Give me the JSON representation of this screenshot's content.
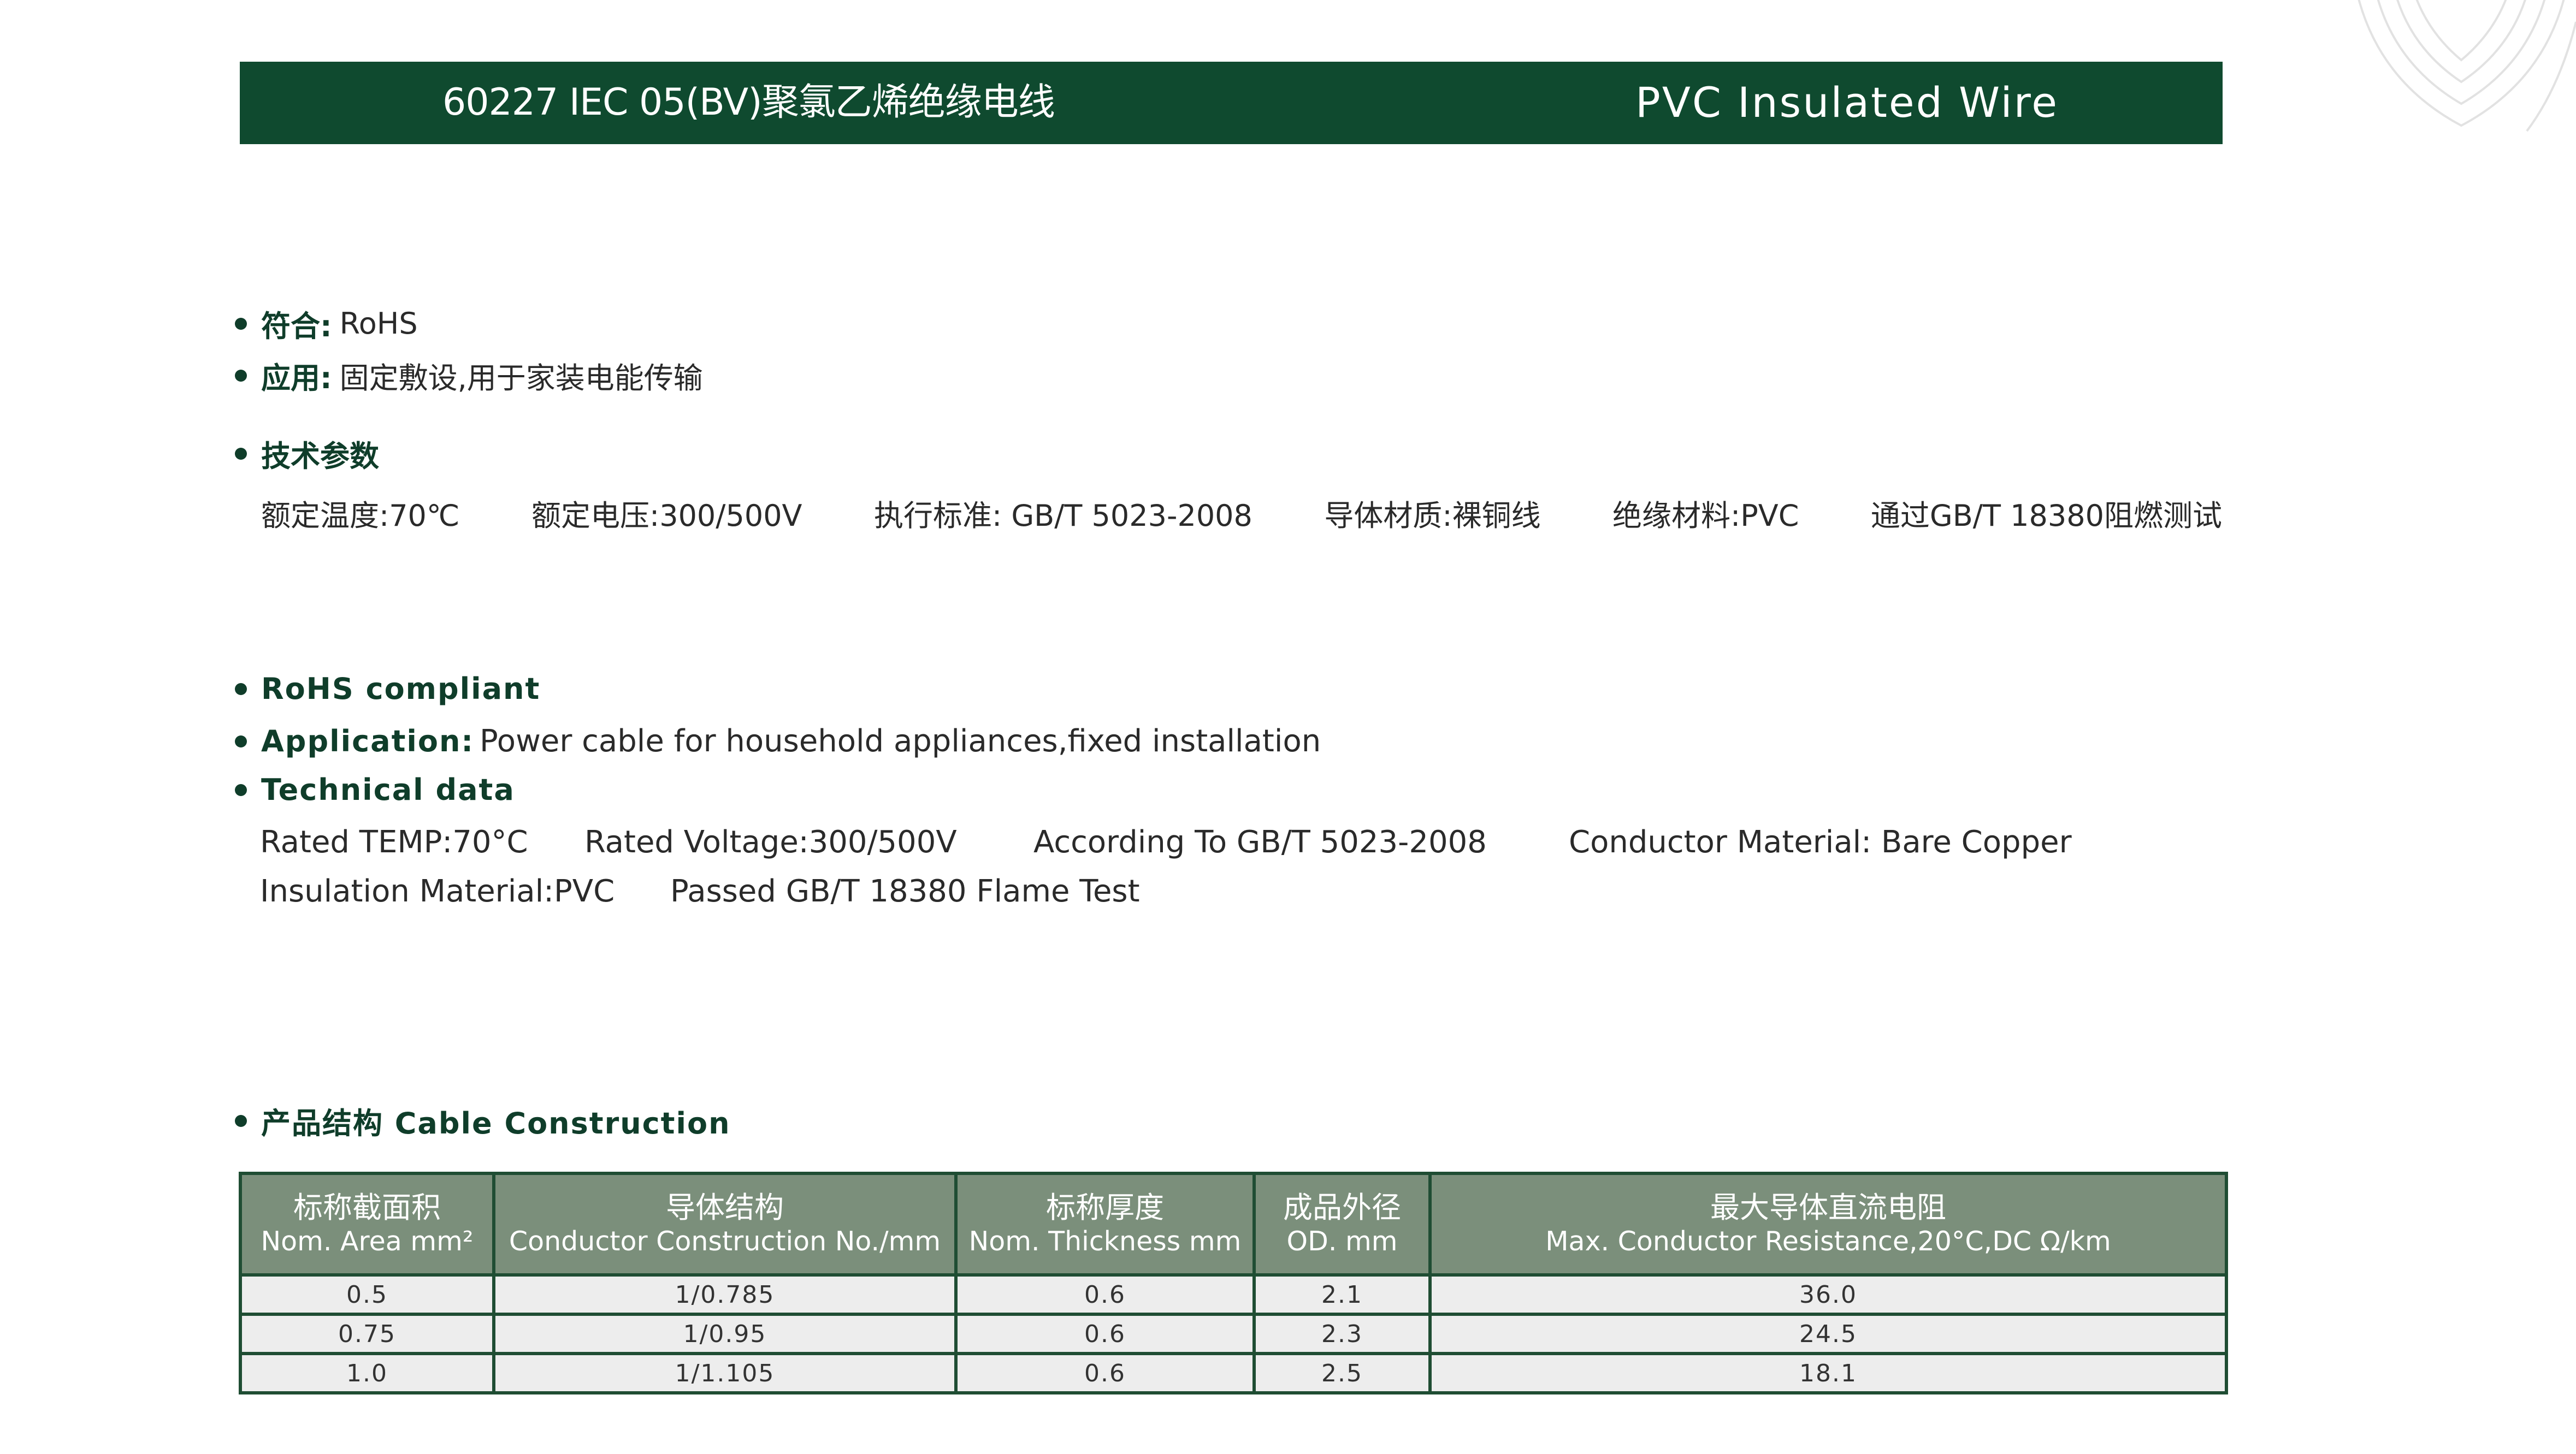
{
  "header": {
    "title_cn": "60227 IEC 05(BV)聚氯乙烯绝缘电线",
    "title_en": "PVC Insulated Wire"
  },
  "cn_section": {
    "compliance_label": "符合:",
    "compliance_value": "RoHS",
    "application_label": "应用:",
    "application_value": "固定敷设,用于家装电能传输",
    "tech_label": "技术参数",
    "params": [
      "额定温度:70℃",
      "额定电压:300/500V",
      "执行标准: GB/T 5023-2008",
      "导体材质:裸铜线",
      "绝缘材料:PVC",
      "通过GB/T 18380阻燃测试"
    ]
  },
  "en_section": {
    "rohs": "RoHS compliant",
    "application_label": "Application:",
    "application_value": "Power cable for household appliances,fixed installation",
    "tech_label": "Technical data",
    "line1": {
      "temp": "Rated TEMP:70°C",
      "voltage": "Rated Voltage:300/500V",
      "standard": "According To GB/T 5023-2008",
      "conductor": "Conductor Material: Bare Copper"
    },
    "line2": {
      "insulation": "Insulation Material:PVC",
      "flame": "Passed GB/T 18380 Flame Test"
    }
  },
  "construction": {
    "heading": "产品结构 Cable Construction",
    "columns": [
      {
        "cn": "标称截面积",
        "en": "Nom. Area mm²"
      },
      {
        "cn": "导体结构",
        "en": "Conductor  Construction No./mm"
      },
      {
        "cn": "标称厚度",
        "en": "Nom. Thickness mm"
      },
      {
        "cn": "成品外径",
        "en": "OD. mm"
      },
      {
        "cn": "最大导体直流电阻",
        "en": "Max. Conductor Resistance,20°C,DC Ω/km"
      }
    ],
    "rows": [
      [
        "0.5",
        "1/0.785",
        "0.6",
        "2.1",
        "36.0"
      ],
      [
        "0.75",
        "1/0.95",
        "0.6",
        "2.3",
        "24.5"
      ],
      [
        "1.0",
        "1/1.105",
        "0.6",
        "2.5",
        "18.1"
      ]
    ]
  }
}
